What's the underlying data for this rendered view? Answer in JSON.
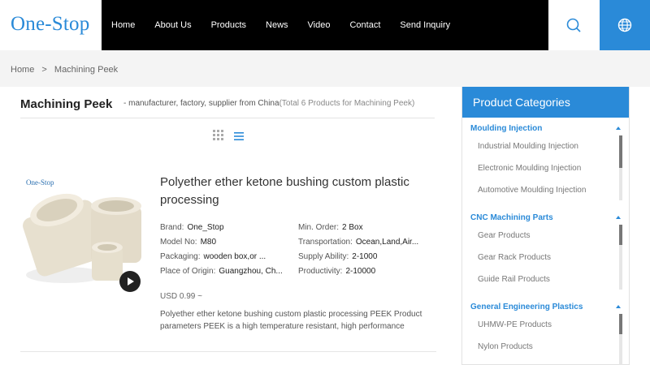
{
  "header": {
    "logo": "One-Stop",
    "nav": [
      "Home",
      "About Us",
      "Products",
      "News",
      "Video",
      "Contact",
      "Send Inquiry"
    ],
    "search_icon": "search-icon",
    "language_icon": "globe-icon",
    "accent_color": "#2a8ad8"
  },
  "breadcrumb": {
    "home": "Home",
    "separator": ">",
    "current": "Machining Peek"
  },
  "listing": {
    "title": "Machining Peek",
    "subtitle": "- manufacturer, factory, supplier from China",
    "count_text": "(Total 6 Products for Machining Peek)"
  },
  "product": {
    "image_brand": "One-Stop",
    "title": "Polyether ether ketone bushing custom plastic processing",
    "specs": [
      {
        "label": "Brand:",
        "value": "One_Stop"
      },
      {
        "label": "Min. Order:",
        "value": "2 Box"
      },
      {
        "label": "Model No:",
        "value": "M80"
      },
      {
        "label": "Transportation:",
        "value": "Ocean,Land,Air..."
      },
      {
        "label": "Packaging:",
        "value": "wooden box,or ..."
      },
      {
        "label": "Supply Ability:",
        "value": "2-1000"
      },
      {
        "label": "Place of Origin:",
        "value": "Guangzhou, Ch..."
      },
      {
        "label": "Productivity:",
        "value": "2-10000"
      }
    ],
    "price": "USD 0.99 ~",
    "description": "Polyether ether ketone bushing custom plastic processing PEEK Product parameters PEEK is a high temperature resistant, high performance"
  },
  "sidebar": {
    "heading": "Product Categories",
    "categories": [
      {
        "name": "Moulding Injection",
        "items": [
          "Industrial Moulding Injection",
          "Electronic Moulding Injection",
          "Automotive Moulding Injection"
        ]
      },
      {
        "name": "CNC Machining Parts",
        "items": [
          "Gear Products",
          "Gear Rack Products",
          "Guide Rail Products"
        ]
      },
      {
        "name": "General Engineering Plastics",
        "items": [
          "UHMW-PE Products",
          "Nylon Products"
        ]
      }
    ]
  }
}
